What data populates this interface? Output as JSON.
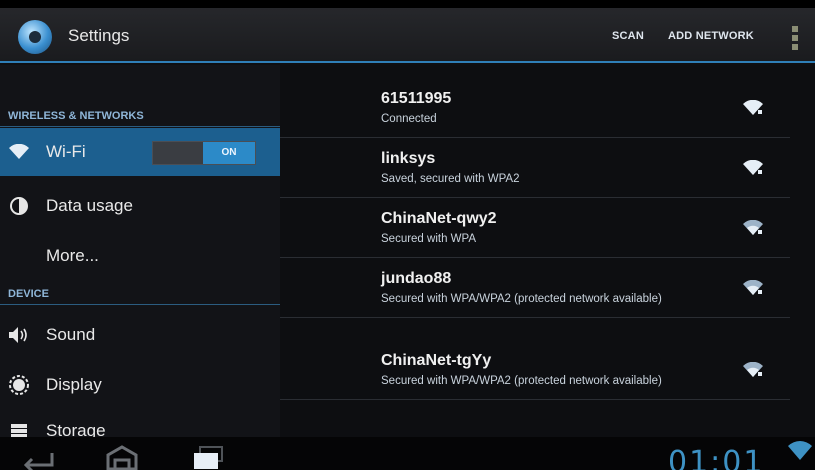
{
  "actionbar": {
    "title": "Settings",
    "scan_label": "SCAN",
    "add_network_label": "ADD NETWORK",
    "app_icon": "settings-gear-icon",
    "overflow_icon": "overflow-menu-icon"
  },
  "sidebar": {
    "sections": [
      {
        "header": "WIRELESS & NETWORKS"
      },
      {
        "header": "DEVICE"
      }
    ],
    "items": [
      {
        "label": "Wi-Fi",
        "icon": "wifi-icon",
        "toggle": "ON"
      },
      {
        "label": "Data usage",
        "icon": "data-usage-icon"
      },
      {
        "label": "More...",
        "icon": ""
      },
      {
        "label": "Sound",
        "icon": "speaker-icon"
      },
      {
        "label": "Display",
        "icon": "display-icon"
      },
      {
        "label": "Storage",
        "icon": "storage-icon"
      }
    ]
  },
  "networks": [
    {
      "ssid": "61511995",
      "status": "Connected"
    },
    {
      "ssid": "linksys",
      "status": "Saved, secured with WPA2"
    },
    {
      "ssid": "ChinaNet-qwy2",
      "status": "Secured with WPA"
    },
    {
      "ssid": "jundao88",
      "status": "Secured with WPA/WPA2 (protected network available)"
    },
    {
      "ssid": "ChinaNet-tgYy",
      "status": "Secured with WPA/WPA2 (protected network available)"
    }
  ],
  "navbar": {
    "clock": "01:01",
    "back_icon": "back-icon",
    "home_icon": "home-icon",
    "recents_icon": "recent-apps-icon"
  },
  "colors": {
    "accent": "#2f7fb8",
    "selected": "#1c5f8f",
    "clock": "#3e92c4"
  }
}
